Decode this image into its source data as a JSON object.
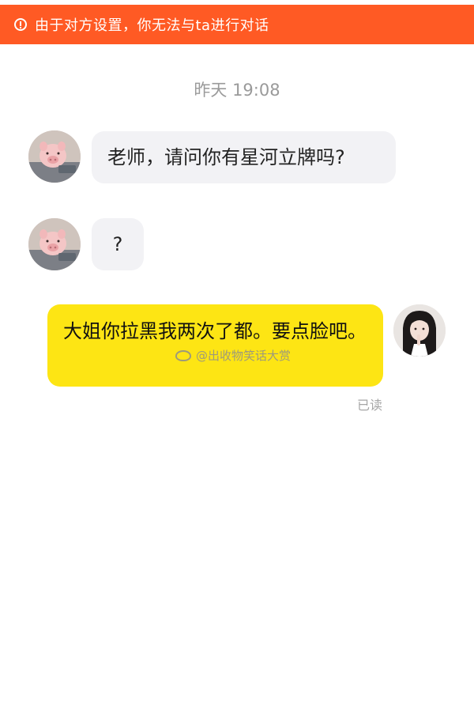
{
  "banner": {
    "text": "由于对方设置，你无法与ta进行对话",
    "icon": "warning-circle-icon",
    "bg_color": "#ff5a24"
  },
  "timestamp": "昨天 19:08",
  "messages": [
    {
      "side": "incoming",
      "avatar": "pig-avatar",
      "text": "老师，请问你有星河立牌吗?"
    },
    {
      "side": "incoming",
      "avatar": "pig-avatar",
      "text": "?"
    },
    {
      "side": "outgoing",
      "avatar": "girl-avatar",
      "text": "大姐你拉黑我两次了都。要点脸吧。",
      "status": "已读"
    }
  ],
  "watermark": "@出收物笑话大赏",
  "colors": {
    "incoming_bubble": "#f2f2f5",
    "outgoing_bubble": "#fde514"
  }
}
